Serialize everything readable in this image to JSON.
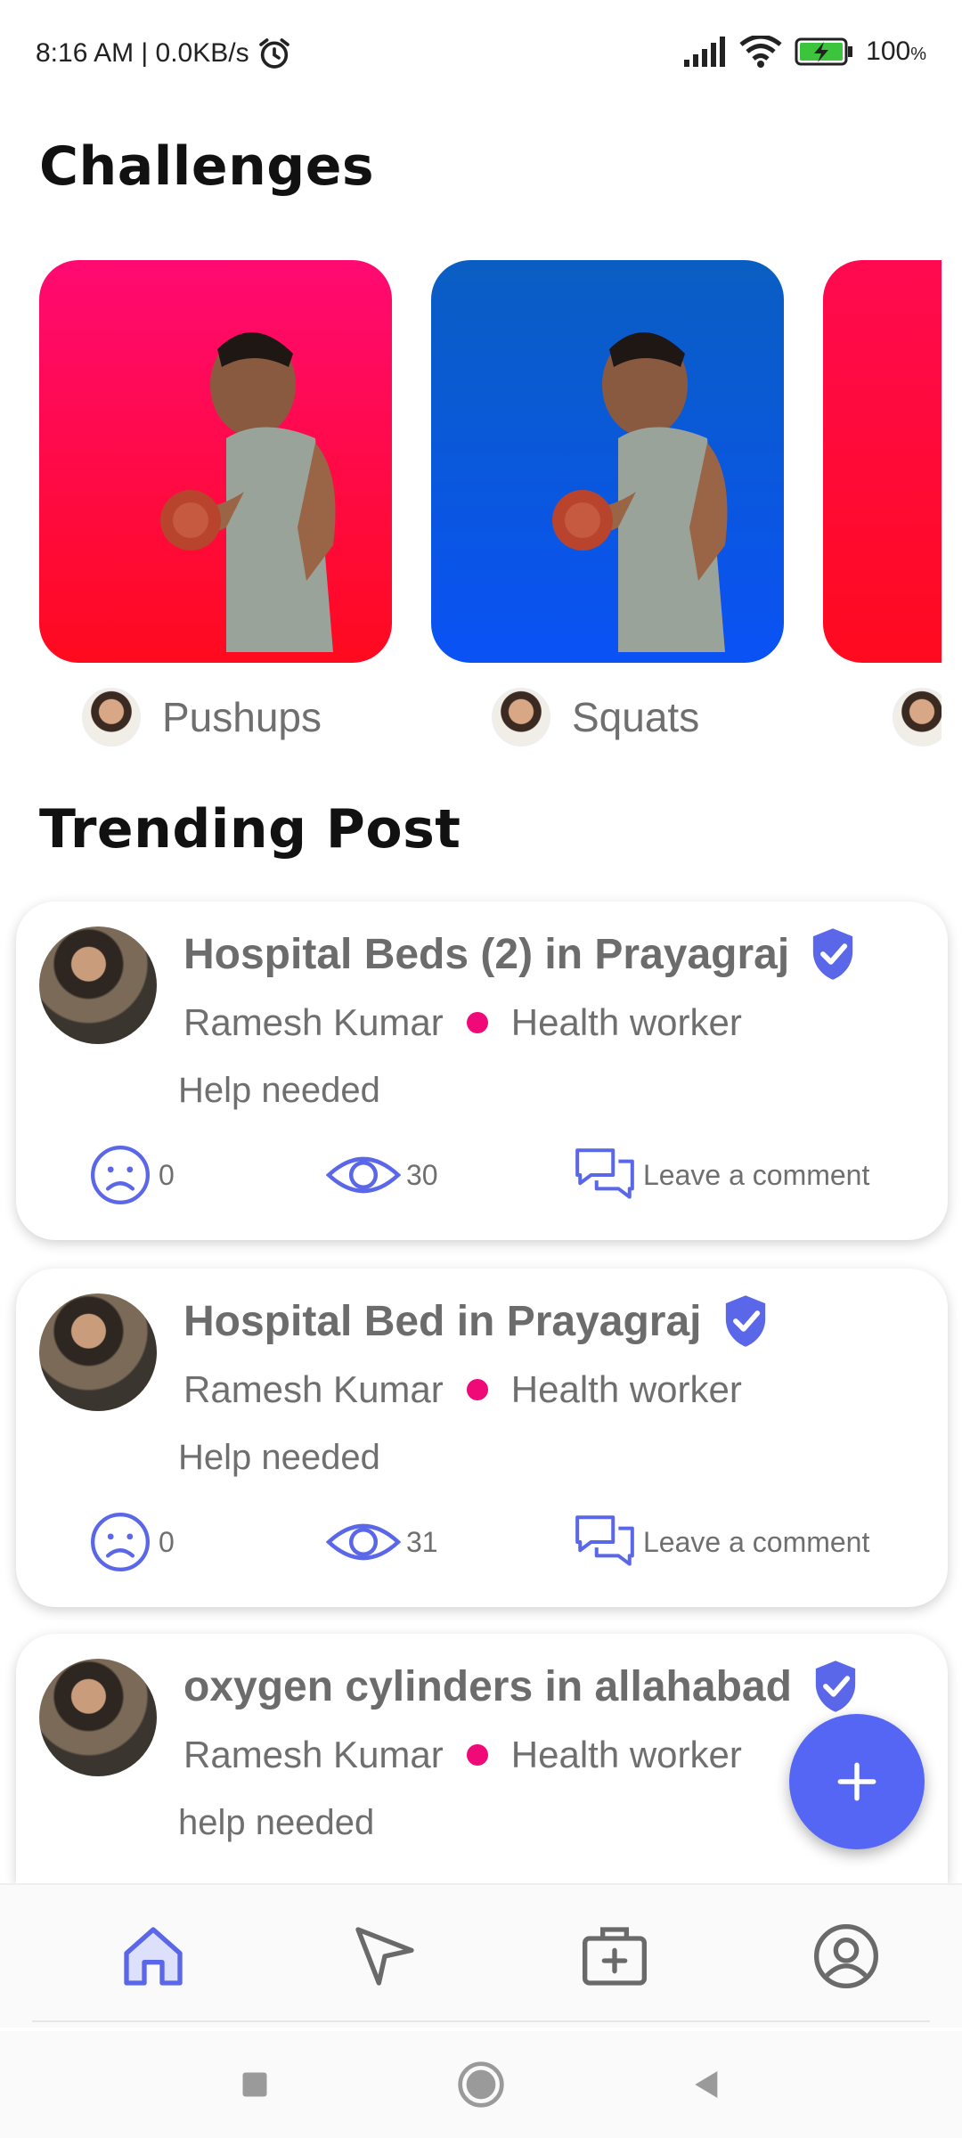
{
  "status_bar": {
    "time_speed": "8:16 AM | 0.0KB/s",
    "battery": "100",
    "battery_unit": "%"
  },
  "challenges": {
    "title": "Challenges",
    "items": [
      {
        "name": "Pushups",
        "gradient": [
          "#ff0a72",
          "#ff0a1e"
        ]
      },
      {
        "name": "Squats",
        "gradient": [
          "#0a5ec2",
          "#0a52f5"
        ]
      },
      {
        "name": "",
        "gradient": [
          "#ff0a50",
          "#ff0a1e"
        ]
      }
    ]
  },
  "trending": {
    "title": "Trending Post",
    "posts": [
      {
        "title": "Hospital Beds (2) in Prayagraj",
        "author": "Ramesh Kumar",
        "role": "Health worker",
        "description": "Help needed",
        "sad_count": "0",
        "views": "30",
        "comment_label": "Leave a comment"
      },
      {
        "title": "Hospital Bed in Prayagraj",
        "author": "Ramesh Kumar",
        "role": "Health worker",
        "description": "Help needed",
        "sad_count": "0",
        "views": "31",
        "comment_label": "Leave a comment"
      },
      {
        "title": "oxygen cylinders in allahabad",
        "author": "Ramesh Kumar",
        "role": "Health worker",
        "description": "help needed",
        "sad_count": "",
        "views": "",
        "comment_label": ""
      }
    ]
  },
  "fab": {
    "icon": "plus-icon"
  },
  "bottom_nav": {
    "items": [
      "home-icon",
      "send-icon",
      "medical-kit-icon",
      "profile-icon"
    ],
    "active_color": "#5a67e8",
    "inactive_color": "#6a6a6a"
  },
  "colors": {
    "accent": "#5566f5",
    "role_dot": "#ef0a78",
    "verified": "#5a67e8"
  }
}
